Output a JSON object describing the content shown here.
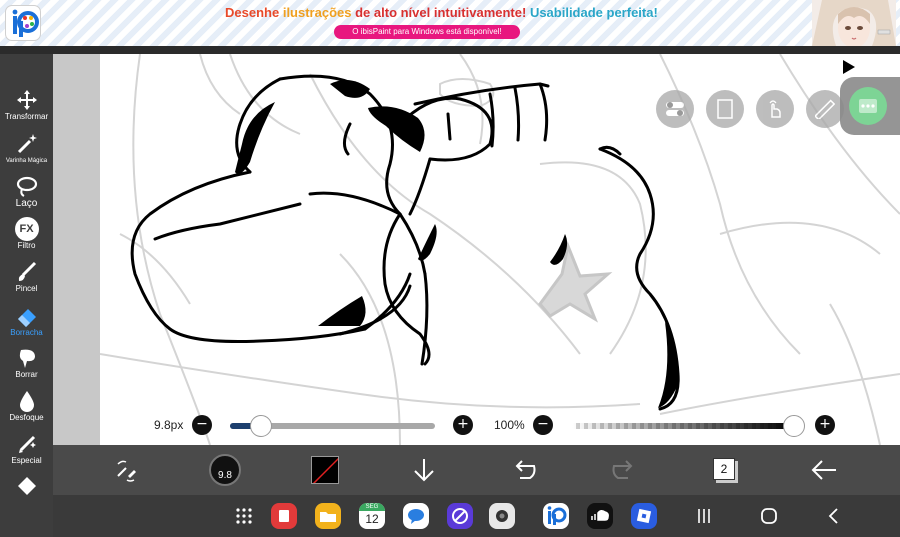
{
  "banner": {
    "headline_word1": "Desenhe",
    "headline_word2": "ilustrações",
    "headline_word3": "de alto nível intuitivamente!",
    "headline_word4": "Usabilidade perfeita!",
    "pill_text": "O ibisPaint para Windows está disponível!"
  },
  "toolbar": {
    "items": [
      {
        "label": "Transformar",
        "icon": "move-arrows-icon"
      },
      {
        "label": "Varinha Mágica",
        "icon": "magic-wand-icon"
      },
      {
        "label": "Laço",
        "icon": "lasso-icon"
      },
      {
        "label": "Filtro",
        "icon": "fx-icon"
      },
      {
        "label": "Pincel",
        "icon": "brush-icon"
      },
      {
        "label": "Borracha",
        "icon": "eraser-icon",
        "active": true
      },
      {
        "label": "Borrar",
        "icon": "smudge-icon"
      },
      {
        "label": "Desfoque",
        "icon": "blur-drop-icon"
      },
      {
        "label": "Especial",
        "icon": "special-pen-icon"
      }
    ],
    "active_color": "#3aa0ff"
  },
  "fx_text": "FX",
  "sliders": {
    "size_label": "9.8px",
    "size_fraction": 0.15,
    "opacity_label": "100%",
    "opacity_fraction": 1.0,
    "minus": "−",
    "plus": "+"
  },
  "bottombar": {
    "brush_size": "9.8",
    "layer_count": "2"
  },
  "navbar": {
    "calendar_day": "12",
    "calendar_weekday": "SEG",
    "apps": [
      "notes-app-icon",
      "files-app-icon",
      "calendar-app-icon",
      "messages-app-icon",
      "browser-app-icon",
      "camera-app-icon",
      "ibispaint-app-icon",
      "soundcloud-app-icon",
      "roblox-app-icon"
    ]
  },
  "colors": {
    "toolbar_bg": "#3d3d3d",
    "canvas_bg": "#ffffff",
    "banner_pill": "#e8177f",
    "menu_green": "#6fd08a"
  }
}
